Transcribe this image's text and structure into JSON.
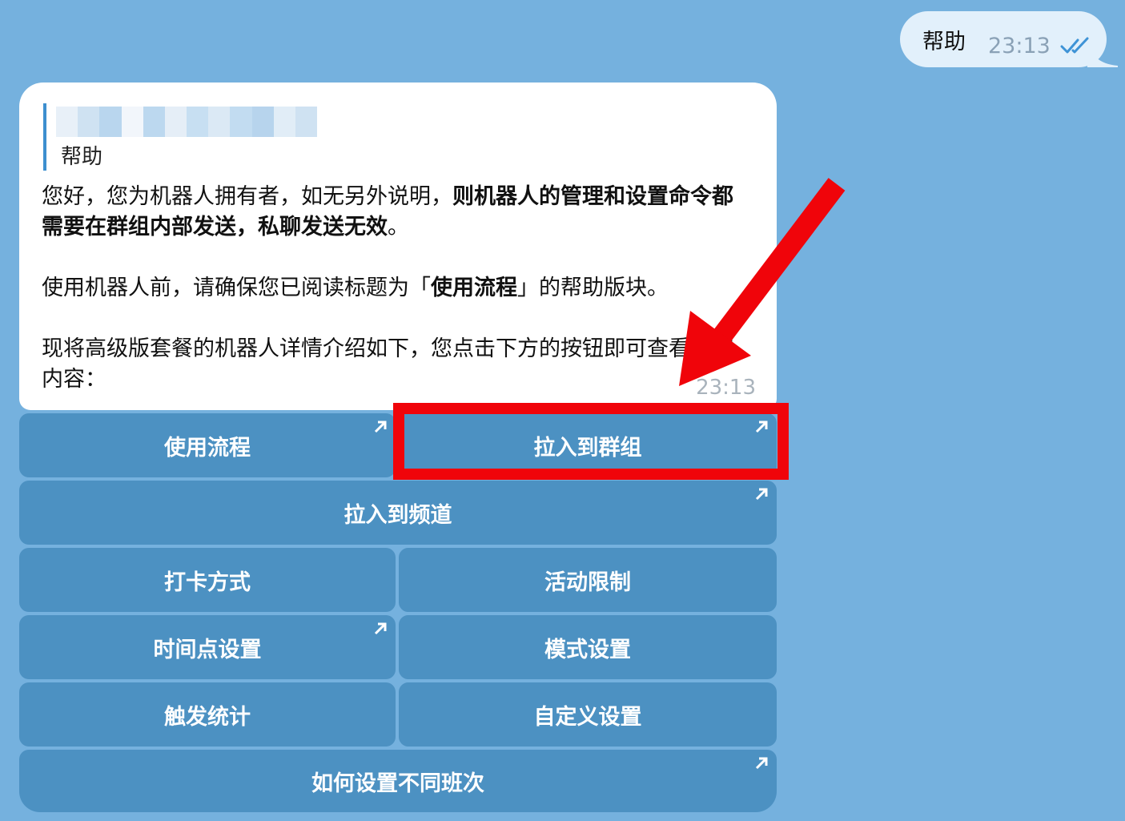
{
  "outgoing": {
    "text": "帮助",
    "time": "23:13",
    "status_icon": "double-check-icon"
  },
  "incoming": {
    "reply_text": "帮助",
    "para1_plain": "您好，您为机器人拥有者，如无另外说明，",
    "para1_bold": "则机器人的管理和设置命令都需要在群组内部发送，私聊发送无效",
    "para1_end": "。",
    "para2_plain": "使用机器人前，请确保您已阅读标题为「",
    "para2_bold": "使用流程",
    "para2_end": "」的帮助版块。",
    "para3": "现将高级版套餐的机器人详情介绍如下，您点击下方的按钮即可查看相应内容：",
    "time": "23:13"
  },
  "buttons": {
    "usage_flow": "使用流程",
    "add_to_group": "拉入到群组",
    "add_to_channel": "拉入到频道",
    "checkin_method": "打卡方式",
    "activity_limit": "活动限制",
    "time_point_settings": "时间点设置",
    "mode_settings": "模式设置",
    "trigger_stats": "触发统计",
    "custom_settings": "自定义设置",
    "shift_setup": "如何设置不同班次"
  },
  "colors": {
    "background": "#75b1de",
    "button": "#4c91c2",
    "highlight": "#f0040a",
    "outgoing_bubble": "#e2f0fb"
  }
}
